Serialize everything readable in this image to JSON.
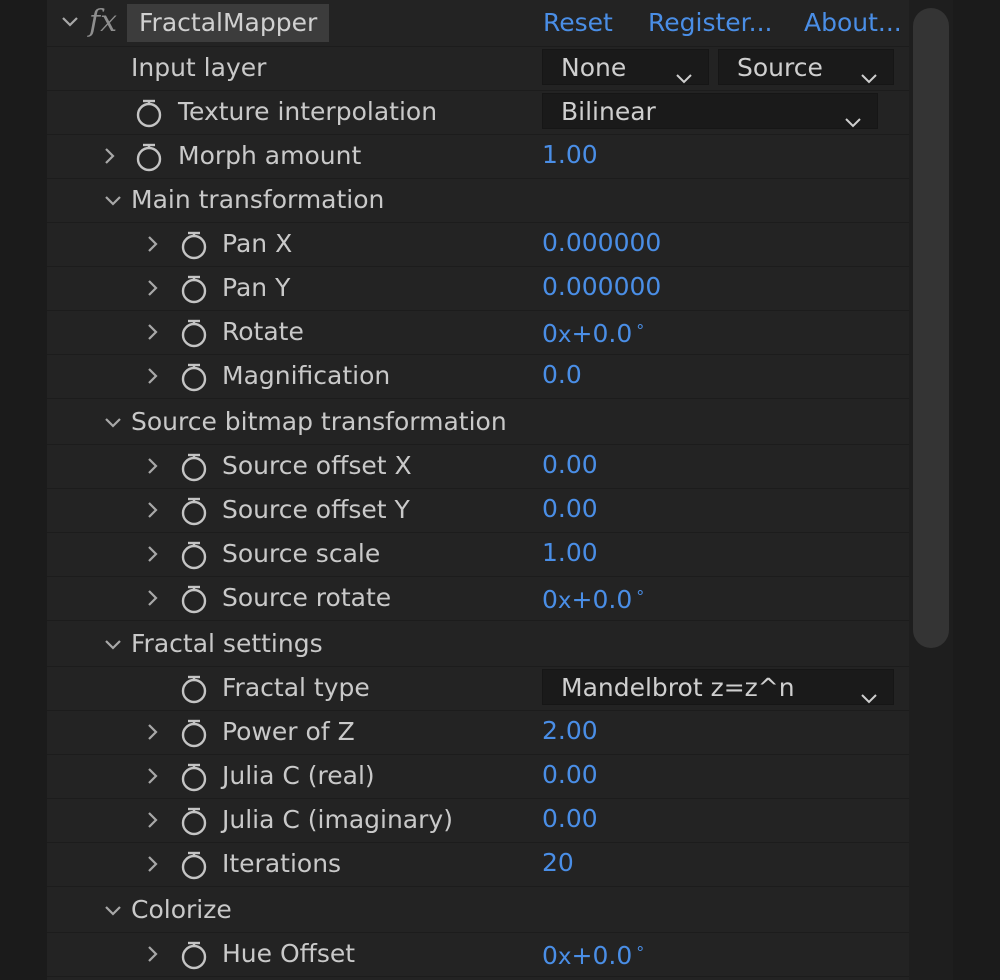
{
  "effect": {
    "name": "FractalMapper",
    "fx_symbol": "fx",
    "links": [
      "Reset",
      "Register...",
      "About..."
    ]
  },
  "input_layer": {
    "label": "Input layer",
    "layer": "None",
    "source": "Source"
  },
  "texture_interpolation": {
    "label": "Texture interpolation",
    "value": "Bilinear"
  },
  "morph_amount": {
    "label": "Morph amount",
    "value": "1.00"
  },
  "main_transformation": {
    "label": "Main transformation",
    "pan_x": {
      "label": "Pan X",
      "value": "0.000000"
    },
    "pan_y": {
      "label": "Pan Y",
      "value": "0.000000"
    },
    "rotate": {
      "label": "Rotate",
      "revolutions": "0",
      "x": "x",
      "degrees": "+0.0",
      "deg_symbol": "°"
    },
    "magnification": {
      "label": "Magnification",
      "value": "0.0"
    }
  },
  "source_bitmap": {
    "label": "Source bitmap transformation",
    "offset_x": {
      "label": "Source offset X",
      "value": "0.00"
    },
    "offset_y": {
      "label": "Source offset Y",
      "value": "0.00"
    },
    "scale": {
      "label": "Source scale",
      "value": "1.00"
    },
    "rotate": {
      "label": "Source rotate",
      "revolutions": "0",
      "x": "x",
      "degrees": "+0.0",
      "deg_symbol": "°"
    }
  },
  "fractal_settings": {
    "label": "Fractal settings",
    "fractal_type": {
      "label": "Fractal type",
      "value": "Mandelbrot z=z^n"
    },
    "power_of_z": {
      "label": "Power of Z",
      "value": "2.00"
    },
    "julia_c_real": {
      "label": "Julia C (real)",
      "value": "0.00"
    },
    "julia_c_imag": {
      "label": "Julia C (imaginary)",
      "value": "0.00"
    },
    "iterations": {
      "label": "Iterations",
      "value": "20"
    }
  },
  "colorize": {
    "label": "Colorize",
    "hue_offset": {
      "label": "Hue Offset",
      "revolutions": "0",
      "x": "x",
      "degrees": "+0.0",
      "deg_symbol": "°"
    }
  },
  "colors": {
    "background": "#1b1b1b",
    "panel": "#232323",
    "text": "#c9c9c9",
    "value_blue": "#4a8ee6",
    "dropdown_bg": "#1a1a1a",
    "name_box": "#3c3c3c"
  }
}
